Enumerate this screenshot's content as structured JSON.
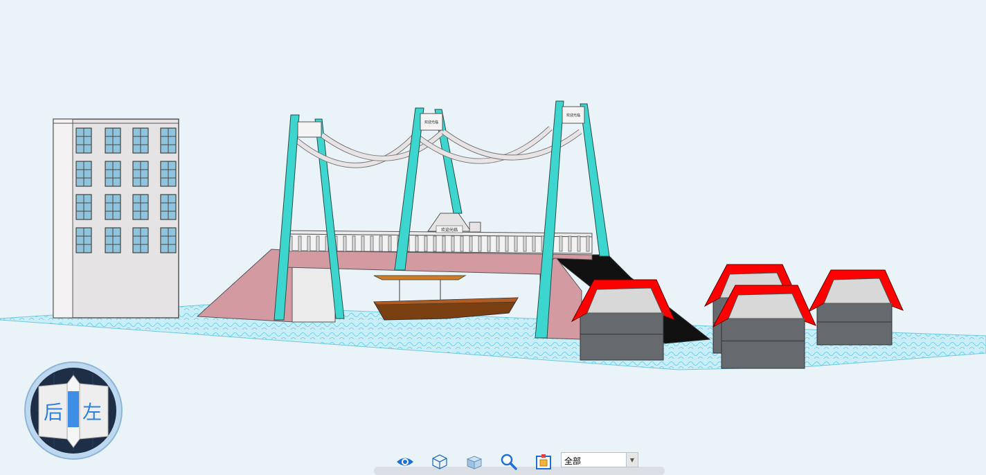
{
  "scene": {
    "bridge_sign_center": "欢迎光临",
    "bridge_sign_left": "欢迎光临",
    "bridge_sign_right": "欢迎光临",
    "bridge_gate_text": "欢迎光临",
    "colors": {
      "background": "#e9f3f8",
      "pylon": "#3dd6cf",
      "deck": "#d49aa2",
      "roof": "#ff0000",
      "house_wall": "#666a6e",
      "boat": "#7a3f10",
      "water": "#6fd3ec"
    }
  },
  "nav_cube": {
    "left_face_label": "后",
    "right_face_label": "左"
  },
  "toolbar": {
    "buttons": [
      {
        "icon": "eye-icon"
      },
      {
        "icon": "wireframe-cube-icon"
      },
      {
        "icon": "shaded-cube-icon"
      },
      {
        "icon": "zoom-icon"
      },
      {
        "icon": "section-box-icon"
      }
    ],
    "filter_value": "全部"
  }
}
